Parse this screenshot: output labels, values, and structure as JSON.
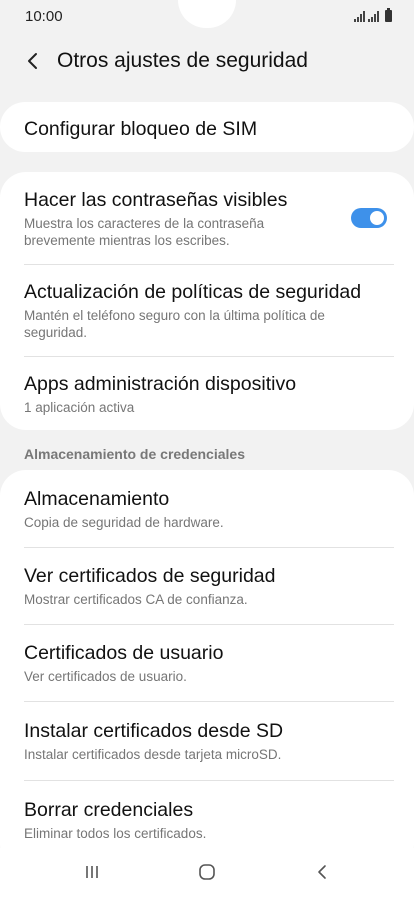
{
  "status_bar": {
    "time": "10:00"
  },
  "header": {
    "title": "Otros ajustes de seguridad"
  },
  "sim_lock": {
    "title": "Configurar bloqueo de SIM"
  },
  "security_group": {
    "items": [
      {
        "title": "Hacer las contraseñas visibles",
        "subtitle": "Muestra los caracteres de la contraseña brevemente mientras los escribes.",
        "toggle_on": true
      },
      {
        "title": "Actualización de políticas de seguridad",
        "subtitle": "Mantén el teléfono seguro con la última política de seguridad."
      },
      {
        "title": "Apps administración dispositivo",
        "subtitle": "1 aplicación activa"
      }
    ]
  },
  "credentials": {
    "header": "Almacenamiento de credenciales",
    "items": [
      {
        "title": "Almacenamiento",
        "subtitle": "Copia de seguridad de hardware."
      },
      {
        "title": "Ver certificados de seguridad",
        "subtitle": "Mostrar certificados CA de confianza."
      },
      {
        "title": "Certificados de usuario",
        "subtitle": "Ver certificados de usuario."
      },
      {
        "title": "Instalar certificados desde SD",
        "subtitle": "Instalar certificados desde tarjeta microSD."
      },
      {
        "title": "Borrar credenciales",
        "subtitle": "Eliminar todos los certificados."
      }
    ]
  },
  "colors": {
    "accent": "#3e91ea",
    "background": "#f2f2f2",
    "card": "#ffffff"
  },
  "icons": {
    "back": "back-arrow-icon",
    "recents": "recents-icon",
    "home": "home-icon",
    "nav_back": "nav-back-icon"
  }
}
